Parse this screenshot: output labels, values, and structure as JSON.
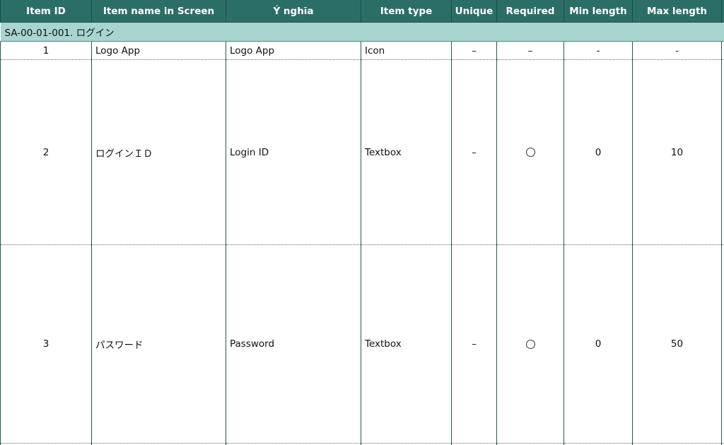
{
  "columns": [
    "Item ID",
    "Item name in Screen",
    "Ý nghĩa",
    "Item type",
    "Unique",
    "Required",
    "Min length",
    "Max length",
    ""
  ],
  "section_title": "SA-00-01-001. ログイン",
  "required_symbol": "circle-icon",
  "rows": [
    {
      "id": "1",
      "name": "Logo App",
      "meaning": "Logo App",
      "type": "Icon",
      "unique": "–",
      "required": "–",
      "min": "-",
      "max": "-"
    },
    {
      "id": "2",
      "name": "ログインＩＤ",
      "meaning": "Login ID",
      "type": "Textbox",
      "unique": "–",
      "required_circle": true,
      "min": "0",
      "max": "10"
    },
    {
      "id": "3",
      "name": "パスワード",
      "meaning": "Password",
      "type": "Textbox",
      "unique": "–",
      "required_circle": true,
      "min": "0",
      "max": "50"
    }
  ],
  "colors": {
    "header_bg": "#2b6e67",
    "section_bg": "#a8d5cf",
    "grid_line": "#1f5b55"
  }
}
